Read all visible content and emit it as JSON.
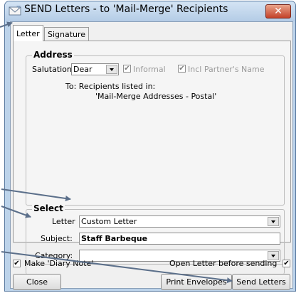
{
  "window": {
    "title": "SEND Letters - to 'Mail-Merge' Recipients",
    "close_glyph": "✕"
  },
  "tabs": [
    {
      "label": "Letter"
    },
    {
      "label": "Signature"
    }
  ],
  "address": {
    "legend": "Address",
    "salutation_label": "Salutation:",
    "salutation_value": "Dear",
    "informal_label": "Informal",
    "informal_checked": true,
    "incl_partner_label": "Incl Partner's Name",
    "incl_partner_checked": true,
    "to_line": "To: Recipients listed in:",
    "source_line": "'Mail-Merge Addresses - Postal'"
  },
  "select": {
    "legend": "Select",
    "letter_label": "Letter",
    "letter_value": "Custom Letter",
    "subject_label": "Subject:",
    "subject_value": "Staff Barbeque",
    "category_label": "Category:",
    "category_value": ""
  },
  "options": {
    "make_diary_label": "Make 'Diary Note'",
    "make_diary_checked": true,
    "open_before_label": "Open Letter before sending",
    "open_before_checked": true
  },
  "buttons": {
    "close": "Close",
    "print_envelopes": "Print Envelopes",
    "send_letters": "Send Letters"
  },
  "check_glyph": "✔",
  "colors": {
    "title_bar": "#c4d8ee",
    "close_button": "#c84a32",
    "annotation_arrow": "#5b6f8a"
  },
  "icons": {
    "app": "envelope-icon",
    "close": "close-icon",
    "dropdown": "chevron-down-icon",
    "annotation": "arrow-pointer"
  }
}
